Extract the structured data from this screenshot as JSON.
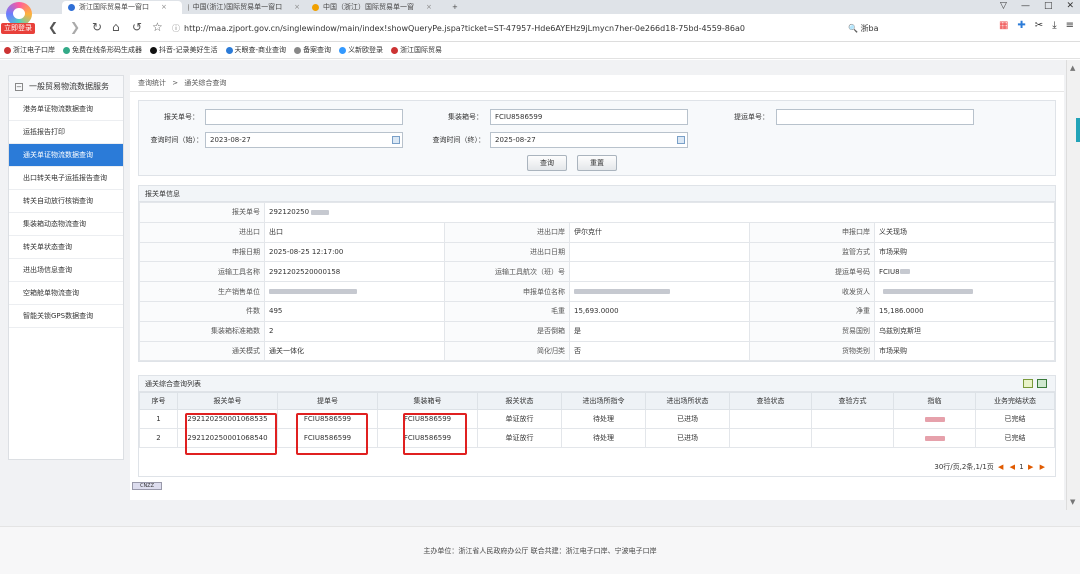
{
  "browser": {
    "badge_label": "立即登录",
    "tabs": [
      {
        "label": "浙江国际贸易单一窗口",
        "active": true
      },
      {
        "label": "中国(浙江)国际贸易单一窗口",
        "active": false
      },
      {
        "label": "中国（浙江）国际贸易单一窗",
        "active": false
      }
    ],
    "new_tab": "+",
    "url": "http://maa.zjport.gov.cn/singlewindow/main/index!showQueryPe.jspa?ticket=ST-47957-Hde6AYEHz9jLmycn7her-0e266d18-75bd-4559-86a0",
    "search_text": "浙ba",
    "bookmarks": [
      "浙江电子口岸",
      "免费在线条形码生成器",
      "抖音-记录美好生活",
      "天眼查-商业查询",
      "备案查询",
      "义新欧登录",
      "浙江国际贸易"
    ]
  },
  "sidebar": {
    "title": "一般贸易物流数据服务",
    "items": [
      {
        "label": "港务单证物流数据查询"
      },
      {
        "label": "运抵报告打印"
      },
      {
        "label": "通关单证物流数据查询"
      },
      {
        "label": "出口转关电子运抵报告查询"
      },
      {
        "label": "转关自动放行核销查询"
      },
      {
        "label": "集装箱动态物流查询"
      },
      {
        "label": "转关单状态查询"
      },
      {
        "label": "进出场信息查询"
      },
      {
        "label": "空箱舱单物流查询"
      },
      {
        "label": "智能关锁GPS数据查询"
      }
    ]
  },
  "breadcrumb": {
    "parent": "查询统计",
    "sep": ">",
    "current": "通关综合查询"
  },
  "query_form": {
    "declaration_no_label": "报关单号：",
    "declaration_no_value": "",
    "container_no_label": "集装箱号：",
    "container_no_value": "FCIU8586599",
    "bill_no_label": "提运单号：",
    "bill_no_value": "",
    "start_time_label": "查询时间（始）：",
    "start_time_value": "2023-08-27",
    "end_time_label": "查询时间（终）：",
    "end_time_value": "2025-08-27",
    "query_button": "查询",
    "reset_button": "重置"
  },
  "info_panel": {
    "title": "报关单信息",
    "rows": [
      {
        "k1": "报关单号",
        "v1": "292120250"
      },
      {
        "k1": "进出口",
        "v1": "出口",
        "k2": "进出口岸",
        "v2": "伊尔克什",
        "k3": "申报口岸",
        "v3": "义关现场"
      },
      {
        "k1": "申报日期",
        "v1": "2025-08-25 12:17:00",
        "k2": "进出口日期",
        "v2": "",
        "k3": "监管方式",
        "v3": "市场采购"
      },
      {
        "k1": "运输工具名称",
        "v1": "2921202520000158",
        "k2": "运输工具航次（班）号",
        "v2": "",
        "k3": "提运单号码",
        "v3": "FCIU8"
      },
      {
        "k1": "生产销售单位",
        "v1": "",
        "k2": "申报单位名称",
        "v2": "",
        "k3": "收发货人",
        "v3": ""
      },
      {
        "k1": "件数",
        "v1": "495",
        "k2": "毛重",
        "v2": "15,693.0000",
        "k3": "净重",
        "v3": "15,186.0000"
      },
      {
        "k1": "集装箱标准箱数",
        "v1": "2",
        "k2": "是否倒箱",
        "v2": "是",
        "k3": "贸易国别",
        "v3": "乌兹别克斯坦"
      },
      {
        "k1": "通关模式",
        "v1": "通关一体化",
        "k2": "简化归类",
        "v2": "否",
        "k3": "货物类别",
        "v3": "市场采购"
      }
    ]
  },
  "list_panel": {
    "title": "通关综合查询列表",
    "columns": [
      "序号",
      "报关单号",
      "提单号",
      "集装箱号",
      "报关状态",
      "进出场所指令",
      "进出场所状态",
      "查验状态",
      "查验方式",
      "指临",
      "业务完结状态"
    ],
    "rows": [
      [
        "1",
        "292120250001068535",
        "FCIU8586599",
        "FCIU8586599",
        "单证放行",
        "待处理",
        "已进场",
        "",
        "",
        "",
        "已完结"
      ],
      [
        "2",
        "292120250001068540",
        "FCIU8586599",
        "FCIU8586599",
        "单证放行",
        "待处理",
        "已进场",
        "",
        "",
        "",
        "已完结"
      ]
    ],
    "pager": {
      "summary": "30行/页,2条,1/1页",
      "first": "◀",
      "prev": "◀",
      "page": "1",
      "next": "▶",
      "last": "▶"
    }
  },
  "cnzz_label": "CNZZ",
  "footer": {
    "text": "主办单位：浙江省人民政府办公厅   联合共建：浙江电子口岸、宁波电子口岸"
  }
}
